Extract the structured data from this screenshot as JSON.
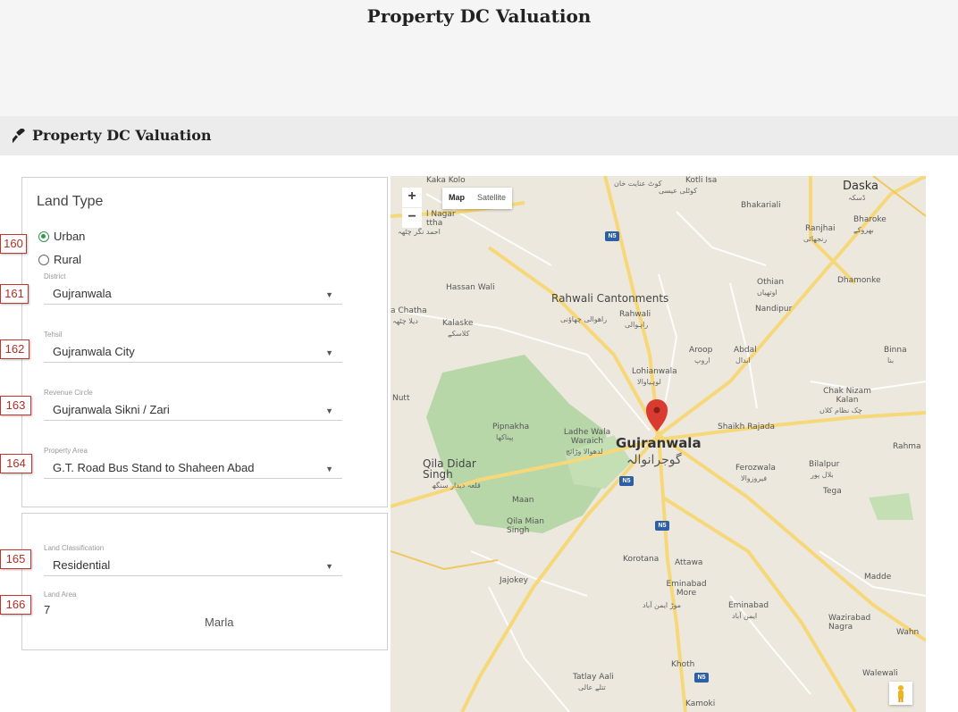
{
  "header": {
    "title": "Property DC Valuation"
  },
  "section": {
    "title": "Property DC Valuation",
    "icon": "gavel-icon"
  },
  "land_type": {
    "heading": "Land Type",
    "options": [
      {
        "label": "Urban",
        "checked": true,
        "tag": "160"
      },
      {
        "label": "Rural",
        "checked": false
      }
    ]
  },
  "fields": {
    "district": {
      "label": "District",
      "value": "Gujranwala",
      "tag": "161"
    },
    "tehsil": {
      "label": "Tehsil",
      "value": "Gujranwala City",
      "tag": "162"
    },
    "revenue_circle": {
      "label": "Revenue Circle",
      "value": "Gujranwala Sikni / Zari",
      "tag": "163"
    },
    "property_area": {
      "label": "Property Area",
      "value": "G.T. Road Bus Stand to Shaheen Abad",
      "tag": "164"
    },
    "land_classification": {
      "label": "Land Classification",
      "value": "Residential",
      "tag": "165"
    },
    "land_area": {
      "label": "Land Area",
      "value": "7",
      "unit": "Marla",
      "tag": "166"
    }
  },
  "map": {
    "toggle": [
      "Map",
      "Satellite"
    ],
    "active_toggle": "Map",
    "zoom_in": "+",
    "zoom_out": "−",
    "places": {
      "daska": "Daska",
      "kaka_kolo": "Kaka Kolo",
      "kotli_isa": "Kotli Isa",
      "bhakariali": "Bhakariali",
      "ranjhai": "Ranjhai",
      "bharoke": "Bharoke",
      "nagar": "l Nagar",
      "ttha": "ttha",
      "hassan_wali": "Hassan Wali",
      "rahwali_cantonments": "Rahwali Cantonments",
      "rahwali": "Rahwali",
      "chatha": "a Chatha",
      "kalaske": "Kalaske",
      "othian": "Othian",
      "dhamonke": "Dhamonke",
      "nandipur": "Nandipur",
      "aroop": "Aroop",
      "abdal": "Abdal",
      "binna": "Binna",
      "lohianwala": "Lohianwala",
      "nutt": "Nutt",
      "chak_nizam_kalan": "Chak Nizam Kalan",
      "pipnakha": "Pipnakha",
      "ladhe_wala_waraich": "Ladhe Wala Waraich",
      "gujranwala": "Gujranwala",
      "shaikh_rajada": "Shaikh Rajada",
      "rahma": "Rahma",
      "qila_didar_singh": "Qila Didar Singh",
      "ferozwala": "Ferozwala",
      "bilalpur": "Bilalpur",
      "tega": "Tega",
      "maan": "Maan",
      "qila_mian_singh": "Qila Mian Singh",
      "korotana": "Korotana",
      "attawa": "Attawa",
      "jajokey": "Jajokey",
      "madde": "Madde",
      "eminabad_more": "Eminabad More",
      "eminabad": "Eminabad",
      "wazirabad_nagra": "Wazirabad Nagra",
      "wahn": "Wahn",
      "khoth": "Khoth",
      "walewali": "Walewali",
      "tatlay_aali": "Tatlay Aali",
      "kamoki": "Kamoki"
    },
    "urdu": {
      "daska": "ڈسکہ",
      "kot_inayat": "کوٹ عنایت خان",
      "kotli_isa": "کوٹلی عیسی",
      "bharoke": "بھروکے",
      "ranjhai": "رنجھائی",
      "nagar": "احمد نگر چٹھہ",
      "rahwali_cantonments": "راھوالی چھاؤنی",
      "rahwali": "راہوالی",
      "chatha": "دیلا چٹھہ",
      "kalaske": "کلاسکے",
      "othian": "اوتھیاں",
      "aroop": "اروپ",
      "abdal": "ابدال",
      "binna": "بنا",
      "lohianwala": "لوہیاوالا",
      "chak_nizam": "چک نظام کلاں",
      "pipnakha": "پپناکھا",
      "ladhe_wala": "لدھوالا وڑائچ",
      "gujranwala": "گوجرانوالہ",
      "ferozwala": "فیروزوالا",
      "bilalpur": "بلال پور",
      "qila_didar": "قلعہ دیدار سنگھ",
      "eminabad_more": "موڑ ایمن آباد",
      "eminabad": "ایمن آباد",
      "tatlay": "تتلے عالی"
    },
    "road_shield": "N5",
    "road_color": "#f6d87a",
    "park_color": "#b7d7a8",
    "marker_color": "#d93b30"
  },
  "colors": {
    "accent_radio": "#2e9a4a",
    "tag_border": "#c7342b"
  }
}
